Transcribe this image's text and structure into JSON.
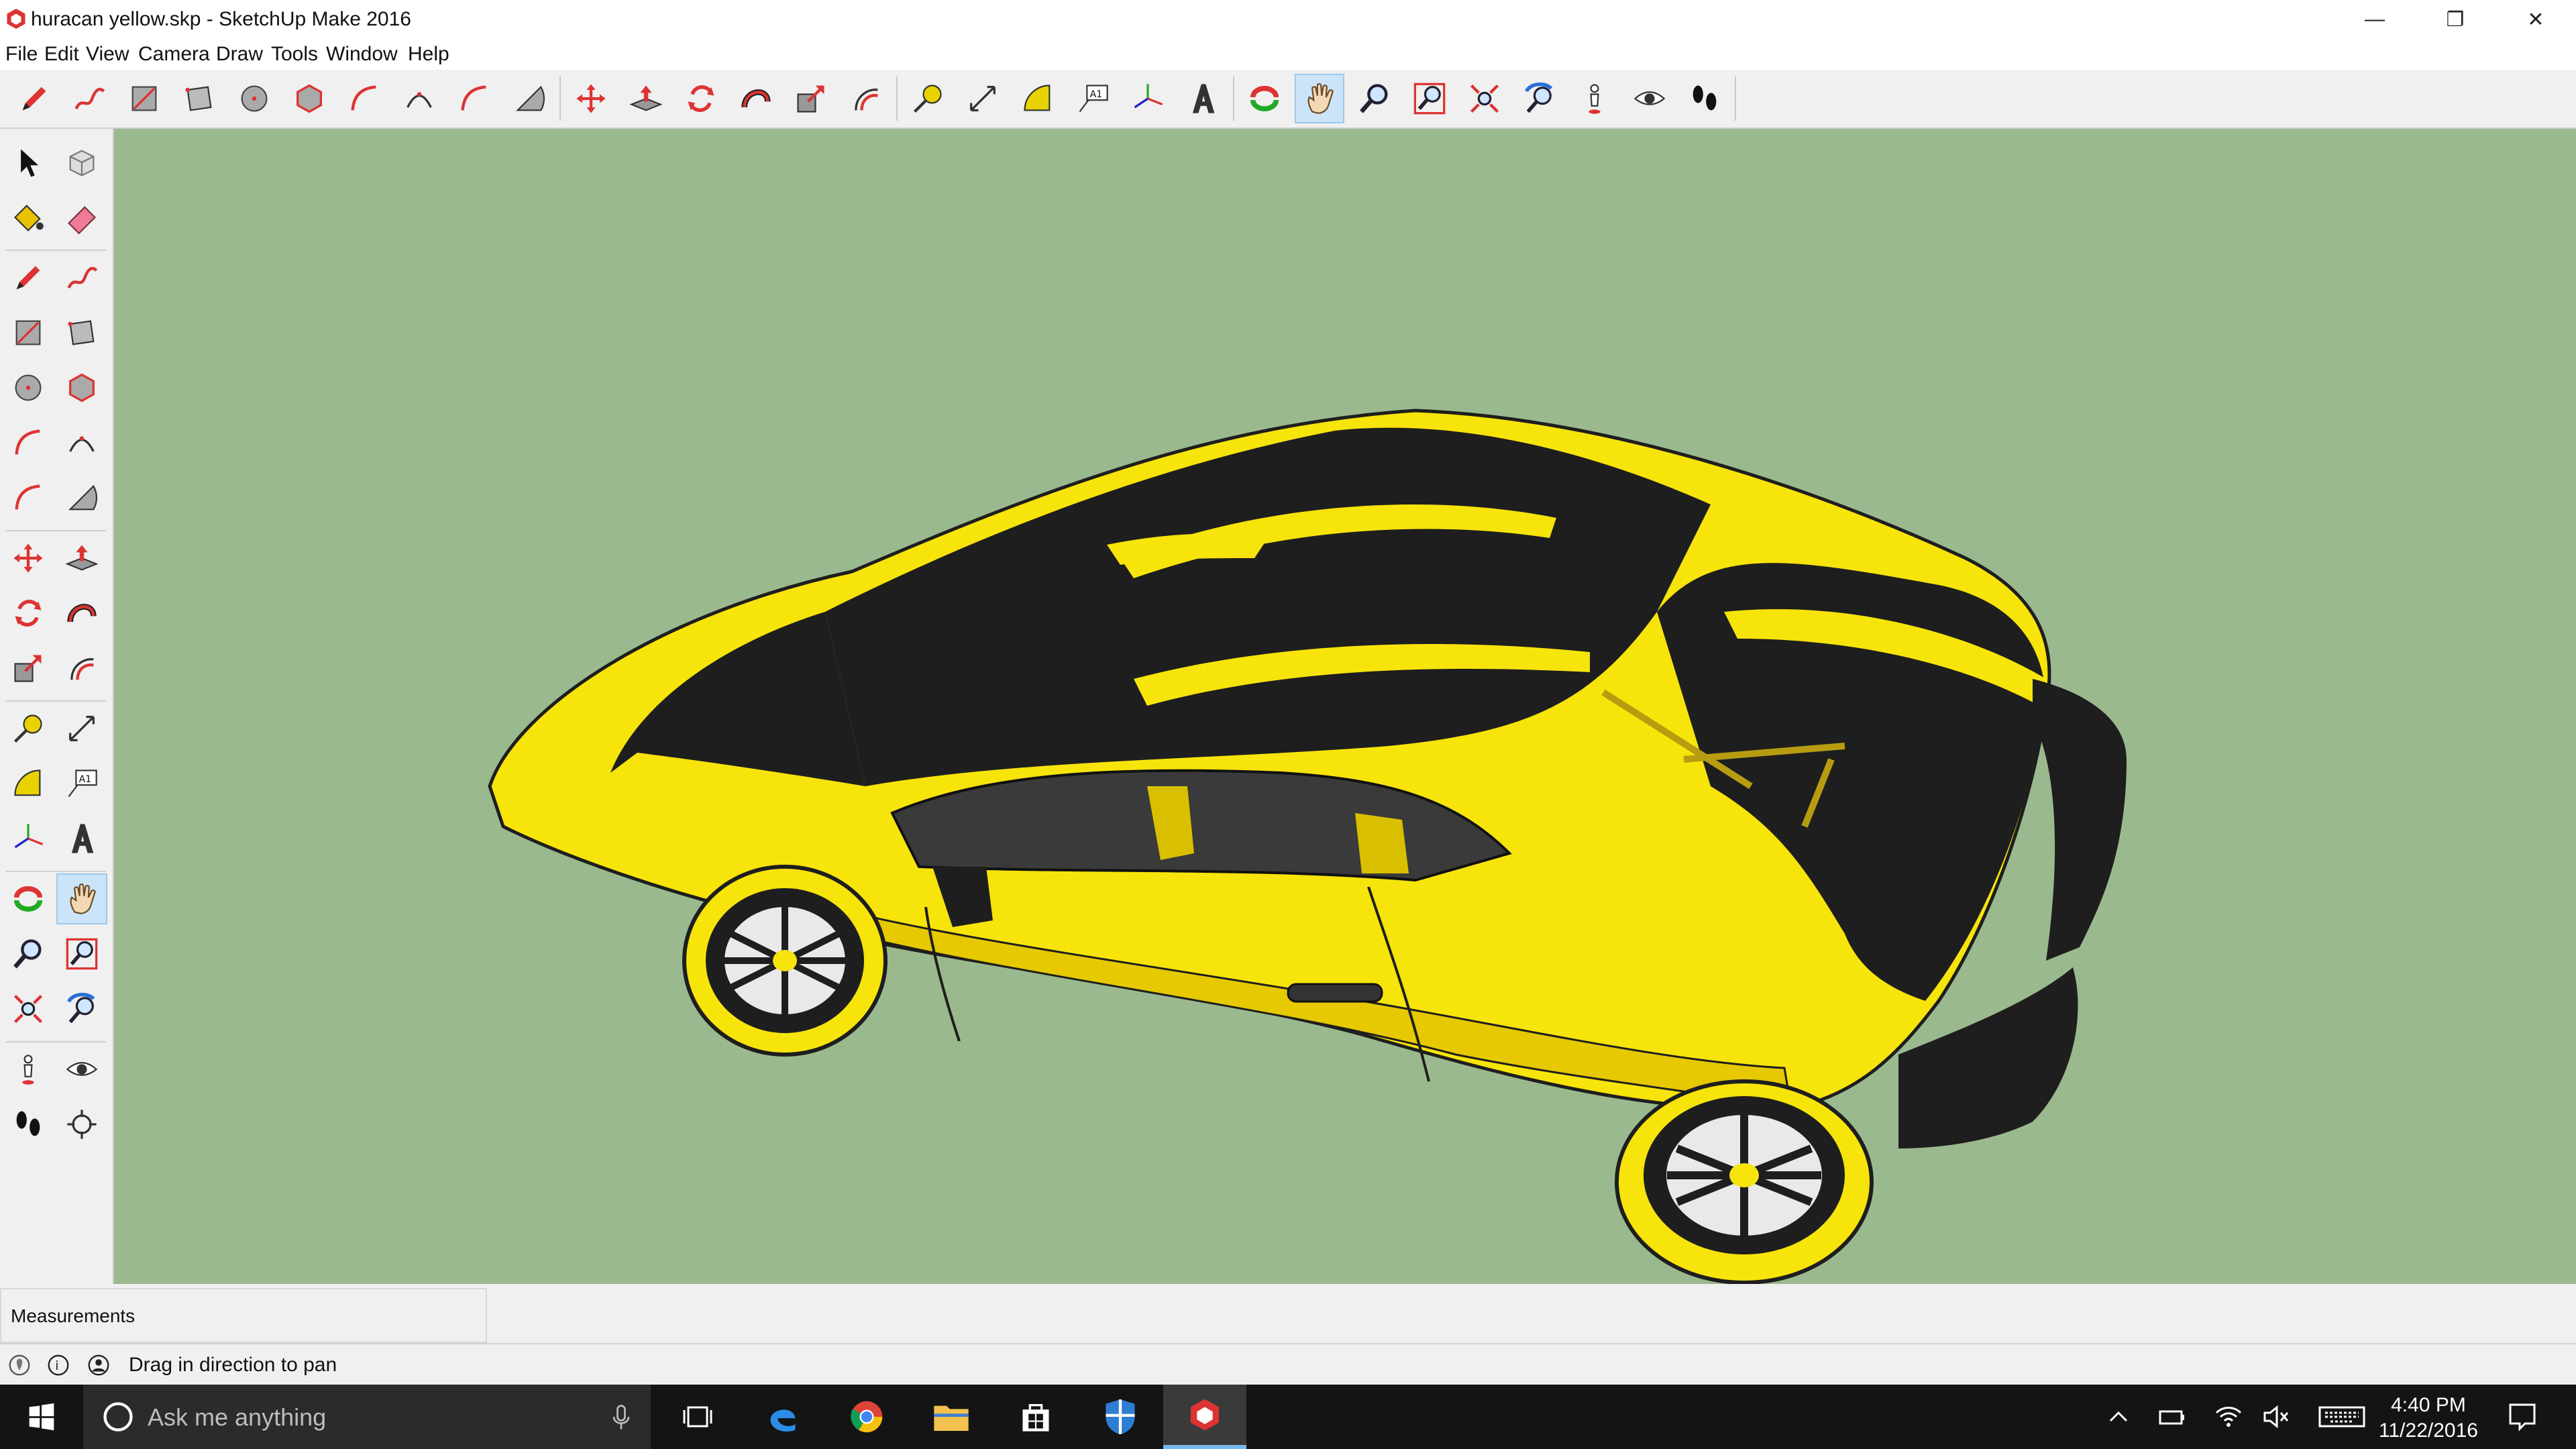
{
  "window": {
    "title": "huracan yellow.skp - SketchUp Make 2016",
    "minimize": "—",
    "restore": "❐",
    "close": "✕"
  },
  "menu": [
    "File",
    "Edit",
    "View",
    "Camera",
    "Draw",
    "Tools",
    "Window",
    "Help"
  ],
  "measurements": {
    "label": "Measurements",
    "value": ""
  },
  "status": {
    "hint": "Drag in direction to pan"
  },
  "taskbar": {
    "search_placeholder": "Ask me anything",
    "time": "4:40 PM",
    "date": "11/22/2016"
  },
  "colors": {
    "viewport_bg": "#9bb98e",
    "car_yellow": "#f7e40b",
    "car_black": "#1e1e1e",
    "accent_red": "#d22a2a"
  },
  "toolbar_icons": [
    "pencil-icon",
    "freehand-icon",
    "rectangle-icon",
    "rotated-rectangle-icon",
    "circle-icon",
    "polygon-icon",
    "arc-icon",
    "two-point-arc-icon",
    "three-point-arc-icon",
    "pie-icon",
    "move-icon",
    "push-pull-icon",
    "rotate-icon",
    "follow-me-icon",
    "scale-icon",
    "offset-icon",
    "tape-measure-icon",
    "dimension-icon",
    "protractor-icon",
    "text-icon",
    "axes-icon",
    "3d-text-icon",
    "orbit-icon",
    "pan-icon",
    "zoom-icon",
    "zoom-window-icon",
    "zoom-extents-icon",
    "previous-view-icon",
    "position-camera-icon",
    "look-around-icon",
    "walk-icon"
  ],
  "palette_icons": [
    "select-icon",
    "make-component-icon",
    "paint-bucket-icon",
    "eraser-icon",
    "pencil-icon",
    "freehand-icon",
    "rectangle-icon",
    "rotated-rectangle-icon",
    "circle-icon",
    "polygon-icon",
    "arc-icon",
    "two-point-arc-icon",
    "three-point-arc-icon",
    "pie-icon",
    "move-icon",
    "push-pull-icon",
    "rotate-icon",
    "follow-me-icon",
    "scale-icon",
    "offset-icon",
    "tape-measure-icon",
    "text-icon",
    "protractor-icon",
    "dimension-icon",
    "axes-icon",
    "3d-text-icon",
    "orbit-icon",
    "pan-icon",
    "zoom-icon",
    "zoom-window-icon",
    "zoom-extents-icon",
    "previous-view-icon",
    "position-camera-icon",
    "look-around-icon",
    "walk-icon",
    "section-plane-icon"
  ]
}
